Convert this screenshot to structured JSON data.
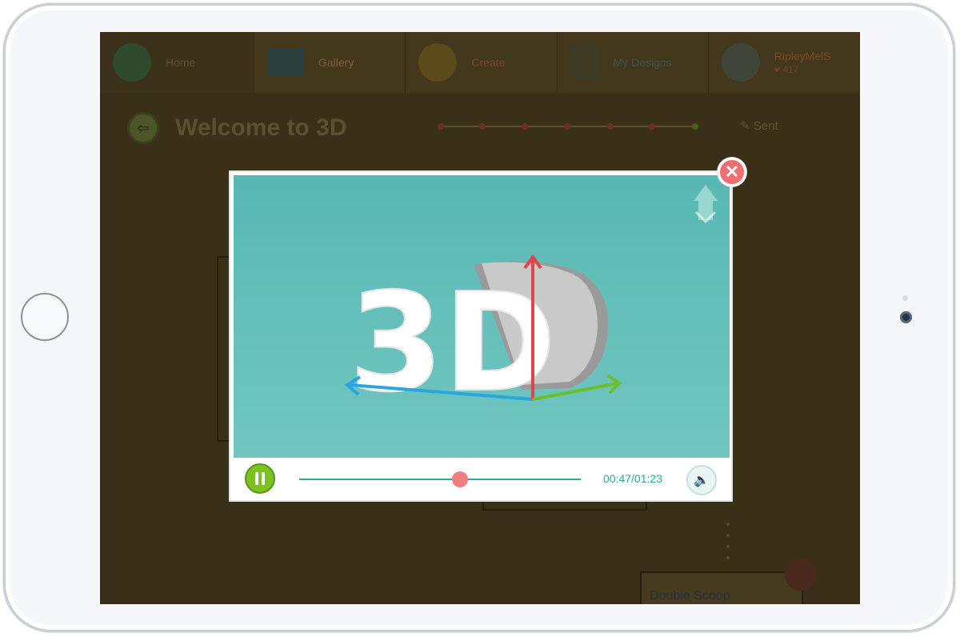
{
  "nav": {
    "items": [
      {
        "label": "Home",
        "icon": "home-globe-icon"
      },
      {
        "label": "Gallery",
        "icon": "gallery-icon"
      },
      {
        "label": "Create",
        "icon": "lightbulb-icon"
      },
      {
        "label": "My Designs",
        "icon": "robot-icon"
      }
    ],
    "user": {
      "name": "RipleyMelS",
      "likes": "417",
      "icon": "user-avatar-icon"
    }
  },
  "page": {
    "title": "Welcome to 3D",
    "progress_status": "Sent"
  },
  "background": {
    "card_label": "Double Scoop"
  },
  "video": {
    "graphic_text": "3D",
    "logo": "brand-logo-icon",
    "elapsed": "00:47",
    "duration": "01:23",
    "time_display": "00:47/01:23",
    "progress_fraction": 0.57
  },
  "colors": {
    "video_bg": "#5fbcb6",
    "accent": "#2aa9a2",
    "play_button": "#7cc022",
    "seek_knob": "#f07e7e",
    "close_button": "#ee6e72",
    "axis_x": "#2aa6df",
    "axis_y": "#e0454e",
    "axis_z": "#6cbf2a"
  }
}
